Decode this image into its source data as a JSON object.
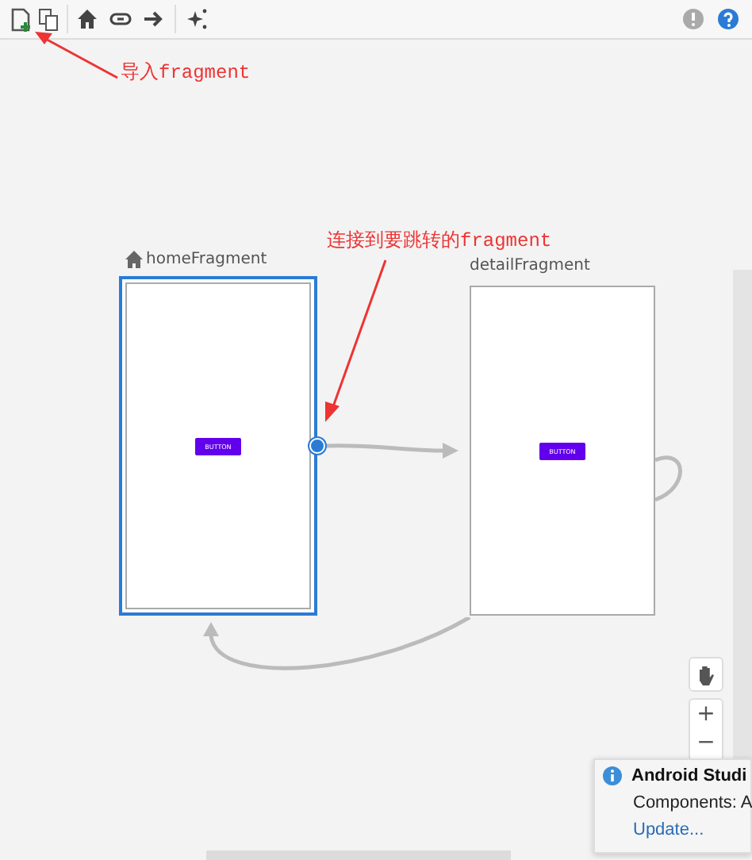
{
  "nodes": [
    {
      "name": "homeFragment",
      "start": true,
      "selected": true,
      "button": "BUTTON"
    },
    {
      "name": "detailFragment",
      "start": false,
      "selected": false,
      "button": "BUTTON"
    }
  ],
  "annotations": [
    "导入fragment",
    "连接到要跳转的fragment"
  ],
  "zoom": {
    "plus": "+",
    "minus": "−"
  },
  "notification": {
    "title": "Android Studi",
    "body": "Components: A",
    "link": "Update..."
  }
}
